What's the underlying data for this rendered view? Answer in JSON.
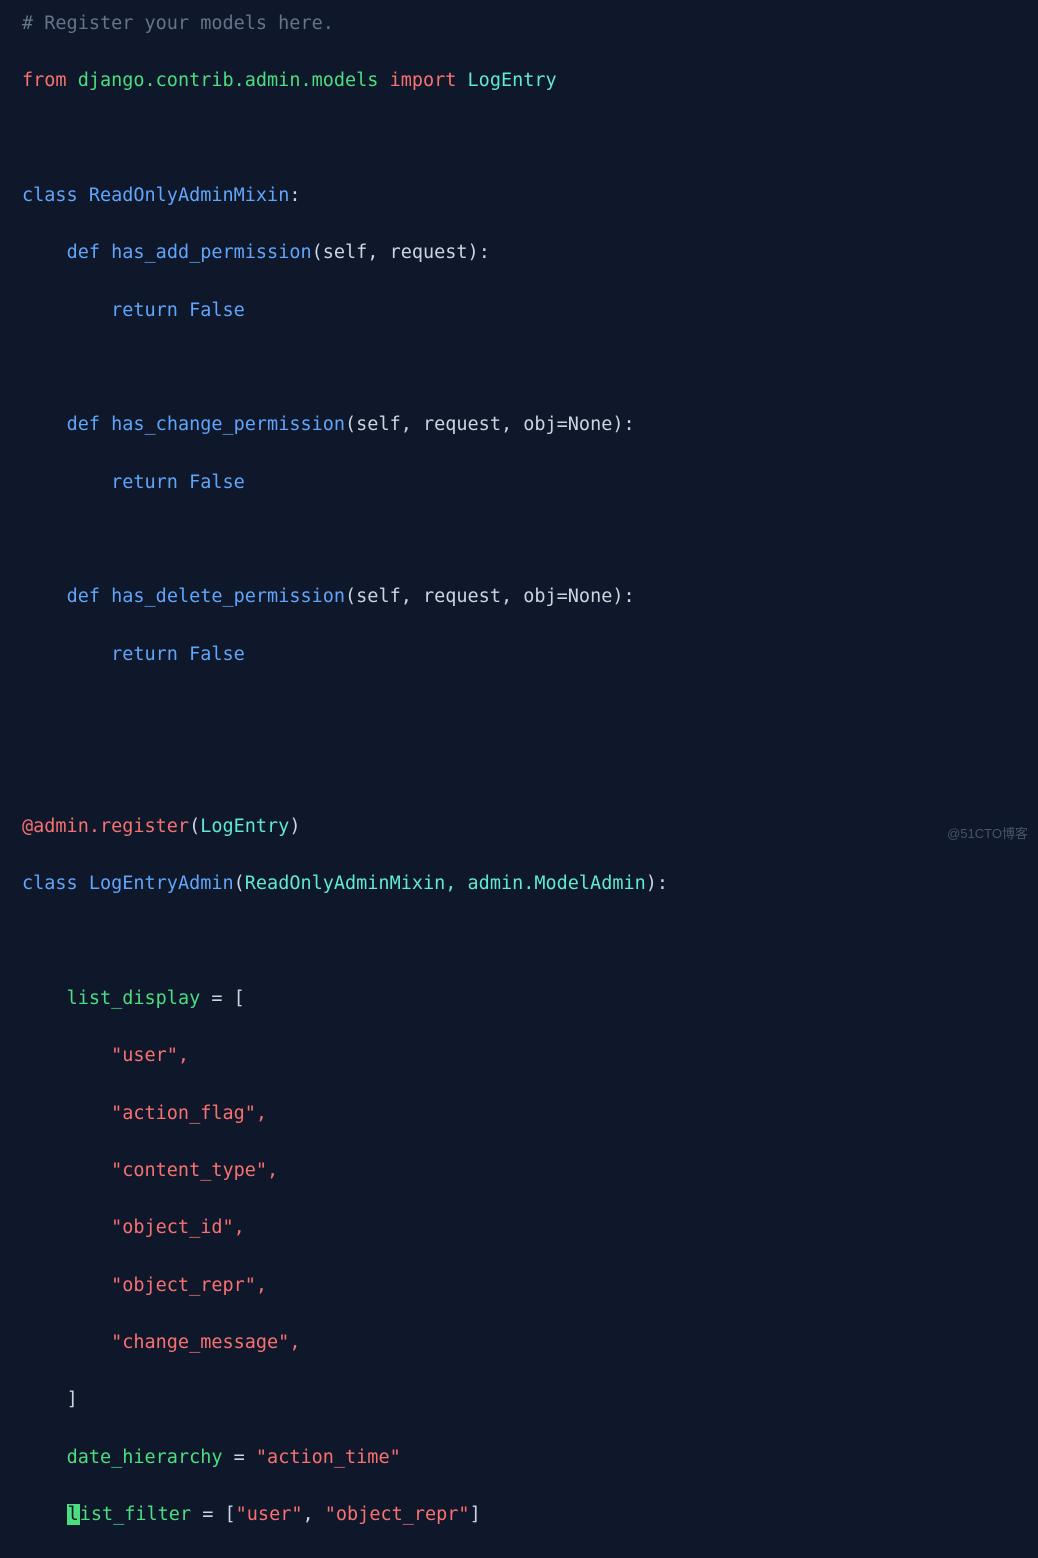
{
  "colors": {
    "background": "#0f172a",
    "comment": "#64748b",
    "keyword_red": "#f87171",
    "keyword_blue": "#60a5fa",
    "green": "#4ade80",
    "teal": "#5eead4",
    "default": "#cbd5e1",
    "cursor_bg": "#4ade80"
  },
  "comment_line": "# Register your models here.",
  "import_line": {
    "from_kw": "from",
    "module": "django.contrib.admin.models",
    "import_kw": "import",
    "name": "LogEntry"
  },
  "mixin_class": {
    "class_kw": "class",
    "name": "ReadOnlyAdminMixin",
    "colon": ":",
    "methods": [
      {
        "def_kw": "def",
        "name": "has_add_permission",
        "params": "(self, request)",
        "colon": ":",
        "return_kw": "return",
        "value": "False"
      },
      {
        "def_kw": "def",
        "name": "has_change_permission",
        "params": "(self, request, obj=None)",
        "colon": ":",
        "return_kw": "return",
        "value": "False"
      },
      {
        "def_kw": "def",
        "name": "has_delete_permission",
        "params": "(self, request, obj=None)",
        "colon": ":",
        "return_kw": "return",
        "value": "False"
      }
    ]
  },
  "decorator": {
    "at": "@",
    "name": "admin.register",
    "open": "(",
    "arg": "LogEntry",
    "close": ")"
  },
  "admin_class": {
    "class_kw": "class",
    "name": "LogEntryAdmin",
    "open": "(",
    "bases": "ReadOnlyAdminMixin, admin.ModelAdmin",
    "close": ")",
    "colon": ":"
  },
  "list_display": {
    "var": "list_display",
    "assign": " = [",
    "items": [
      "\"user\",",
      "\"action_flag\",",
      "\"content_type\",",
      "\"object_id\",",
      "\"object_repr\",",
      "\"change_message\","
    ],
    "close": "]"
  },
  "date_hierarchy": {
    "var": "date_hierarchy",
    "assign": " = ",
    "value": "\"action_time\""
  },
  "list_filter": {
    "cursor_char": "l",
    "var_rest": "ist_filter",
    "assign": " = [",
    "v1": "\"user\"",
    "comma": ", ",
    "v2": "\"object_repr\"",
    "close": "]"
  },
  "watermark": "@51CTO博客"
}
